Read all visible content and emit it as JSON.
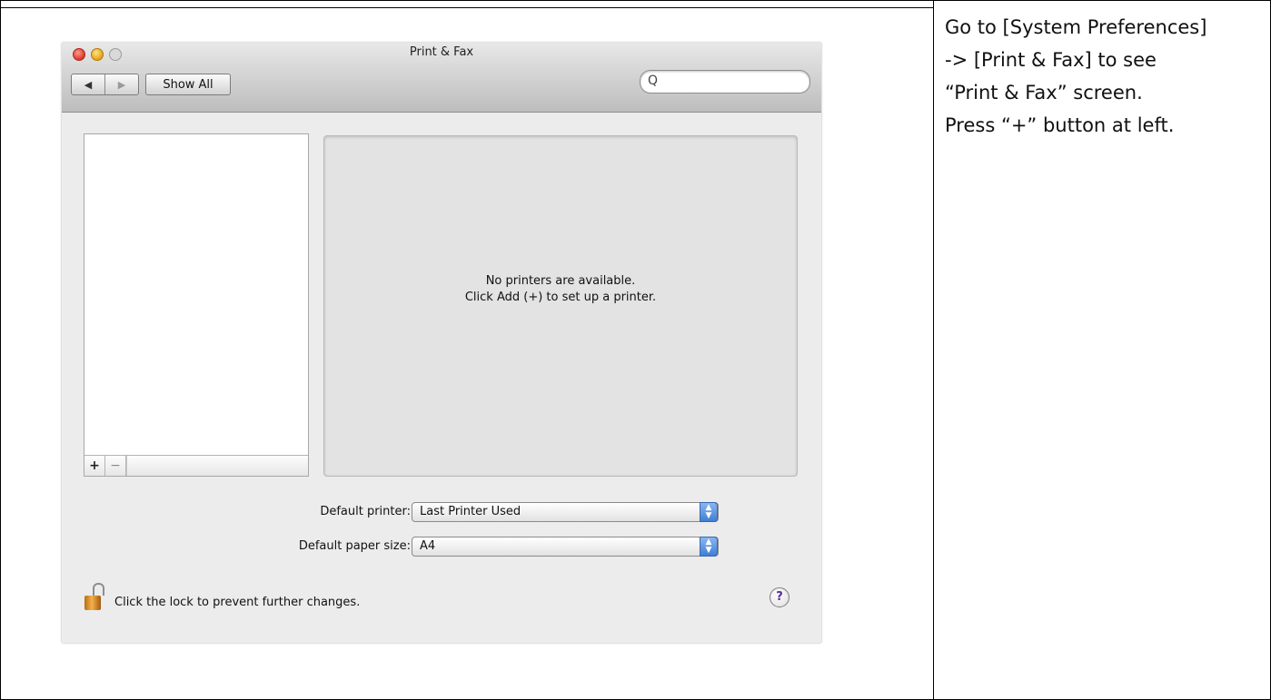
{
  "window": {
    "title": "Print & Fax",
    "nav_back": "◀",
    "nav_forward": "▶",
    "show_all": "Show All",
    "search_placeholder": "",
    "search_icon": "Q"
  },
  "printer_list": {
    "add_label": "+",
    "remove_label": "−"
  },
  "detail": {
    "message_line1": "No printers are available.",
    "message_line2": "Click Add (+) to set up a printer."
  },
  "settings": {
    "default_printer_label": "Default printer:",
    "default_printer_value": "Last Printer Used",
    "default_paper_label": "Default paper size:",
    "default_paper_value": "A4"
  },
  "footer": {
    "lock_text": "Click the lock to prevent further changes.",
    "help_label": "?"
  },
  "caption": {
    "line1": "Go to [System Preferences]",
    "line2": "-> [Print & Fax] to see",
    "line3": "“Print & Fax” screen.",
    "line4": "Press “+” button at left."
  },
  "colors": {
    "stepper_blue": "#3f7fd6",
    "lock_orange": "#f2b24a",
    "close_red": "#d9382b",
    "minimize_yellow": "#e6a314"
  }
}
